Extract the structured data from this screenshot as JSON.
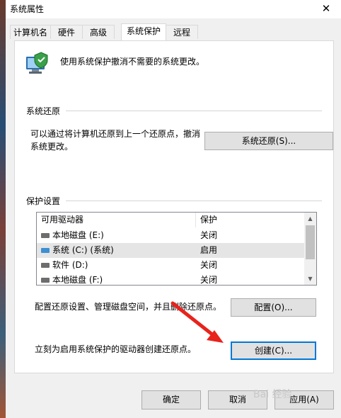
{
  "window": {
    "title": "系统属性",
    "close_glyph": "✕"
  },
  "tabs": [
    {
      "label": "计算机名"
    },
    {
      "label": "硬件"
    },
    {
      "label": "高级"
    },
    {
      "label": "系统保护",
      "active": true
    },
    {
      "label": "远程"
    }
  ],
  "intro": {
    "text": "使用系统保护撤消不需要的系统更改。",
    "icon": "computer-shield-icon"
  },
  "restore": {
    "group_label": "系统还原",
    "description_line1": "可以通过将计算机还原到上一个还原点，撤消",
    "description_line2": "系统更改。",
    "button_label": "系统还原(S)..."
  },
  "protection": {
    "group_label": "保护设置",
    "columns": {
      "drive": "可用驱动器",
      "protection": "保护"
    },
    "rows": [
      {
        "name": "本地磁盘 (E:)",
        "status": "关闭",
        "icon": "drive-icon"
      },
      {
        "name": "系统 (C:) (系统)",
        "status": "启用",
        "icon": "system-drive-icon",
        "selected": true
      },
      {
        "name": "软件 (D:)",
        "status": "关闭",
        "icon": "drive-icon"
      },
      {
        "name": "本地磁盘 (F:)",
        "status": "关闭",
        "icon": "drive-icon"
      }
    ],
    "configure_text": "配置还原设置、管理磁盘空间，并且删除还原点。",
    "configure_button": "配置(O)...",
    "create_text": "立刻为启用系统保护的驱动器创建还原点。",
    "create_button": "创建(C)..."
  },
  "footer": {
    "ok": "确定",
    "cancel": "取消",
    "apply": "应用(A)"
  },
  "watermark": "Bai 经验",
  "colors": {
    "accent": "#0078d7",
    "annotation_arrow": "#e8231c"
  }
}
